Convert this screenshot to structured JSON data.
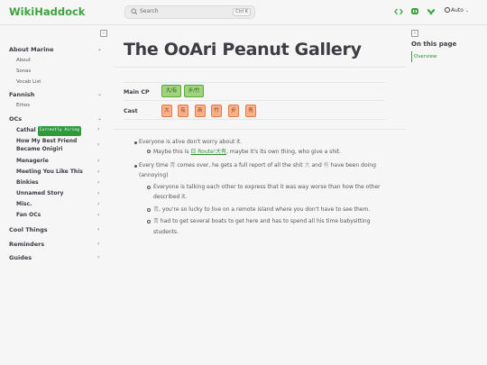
{
  "app": {
    "brand": "WikiHaddock"
  },
  "search": {
    "placeholder": "Search",
    "shortcut": "Ctrl K"
  },
  "nav": {
    "theme_label": "Auto",
    "icons": [
      "code-icon",
      "mastodon-icon",
      "bluesky-icon",
      "gear-icon"
    ]
  },
  "sidebar": {
    "about": {
      "label": "About Marine",
      "items": [
        "About",
        "Sonas",
        "Vocab List"
      ]
    },
    "fannish": {
      "label": "Fannish",
      "items": [
        "Ethos"
      ]
    },
    "ocs": {
      "label": "OCs",
      "items": [
        {
          "label": "Cathal",
          "badge": "Currently Airing"
        },
        {
          "label": "How My Best Friend Became Onigiri"
        },
        {
          "label": "Menagerie"
        },
        {
          "label": "Meeting You Like This"
        },
        {
          "label": "Binkies"
        },
        {
          "label": "Unnamed Story"
        },
        {
          "label": "Misc."
        },
        {
          "label": "Fan OCs"
        }
      ]
    },
    "cool_things": "Cool Things",
    "reminders": "Reminders",
    "guides": "Guides"
  },
  "toc": {
    "title": "On this page",
    "items": [
      "Overview"
    ]
  },
  "main": {
    "title": "The OoAri Peanut Gallery",
    "main_cp_label": "Main CP",
    "main_cp": [
      "大/有",
      "步/竹"
    ],
    "cast_label": "Cast",
    "cast": [
      "大",
      "有",
      "新",
      "竹",
      "步",
      "青"
    ],
    "bullets": {
      "b1": "Everyone is alive don't worry about it.",
      "b1_sub_pre": "Maybe this is ",
      "b1_sub_link": "日 Route!大有",
      "b1_sub_post": ", maybe it's its own thing, who give a shit.",
      "b2_pre": "Every time ",
      "b2_char1": "青",
      "b2_mid": " comes over, he gets a full report of all the shit ",
      "b2_char2": "大",
      "b2_and": " and ",
      "b2_char3": "有",
      "b2_post": " have been doing",
      "b2_line2": "(annoying)",
      "s1": "Everyone is talking each other to express that it was way worse than how the other",
      "s1_line2": "described it.",
      "s2_char": "青",
      "s2": ", you're so lucky to live on a remote island where you don't have to see them.",
      "s3_char": "青",
      "s3": " had to get several boats to get here and has to spend all his time babysitting",
      "s3_line2": "students."
    }
  }
}
